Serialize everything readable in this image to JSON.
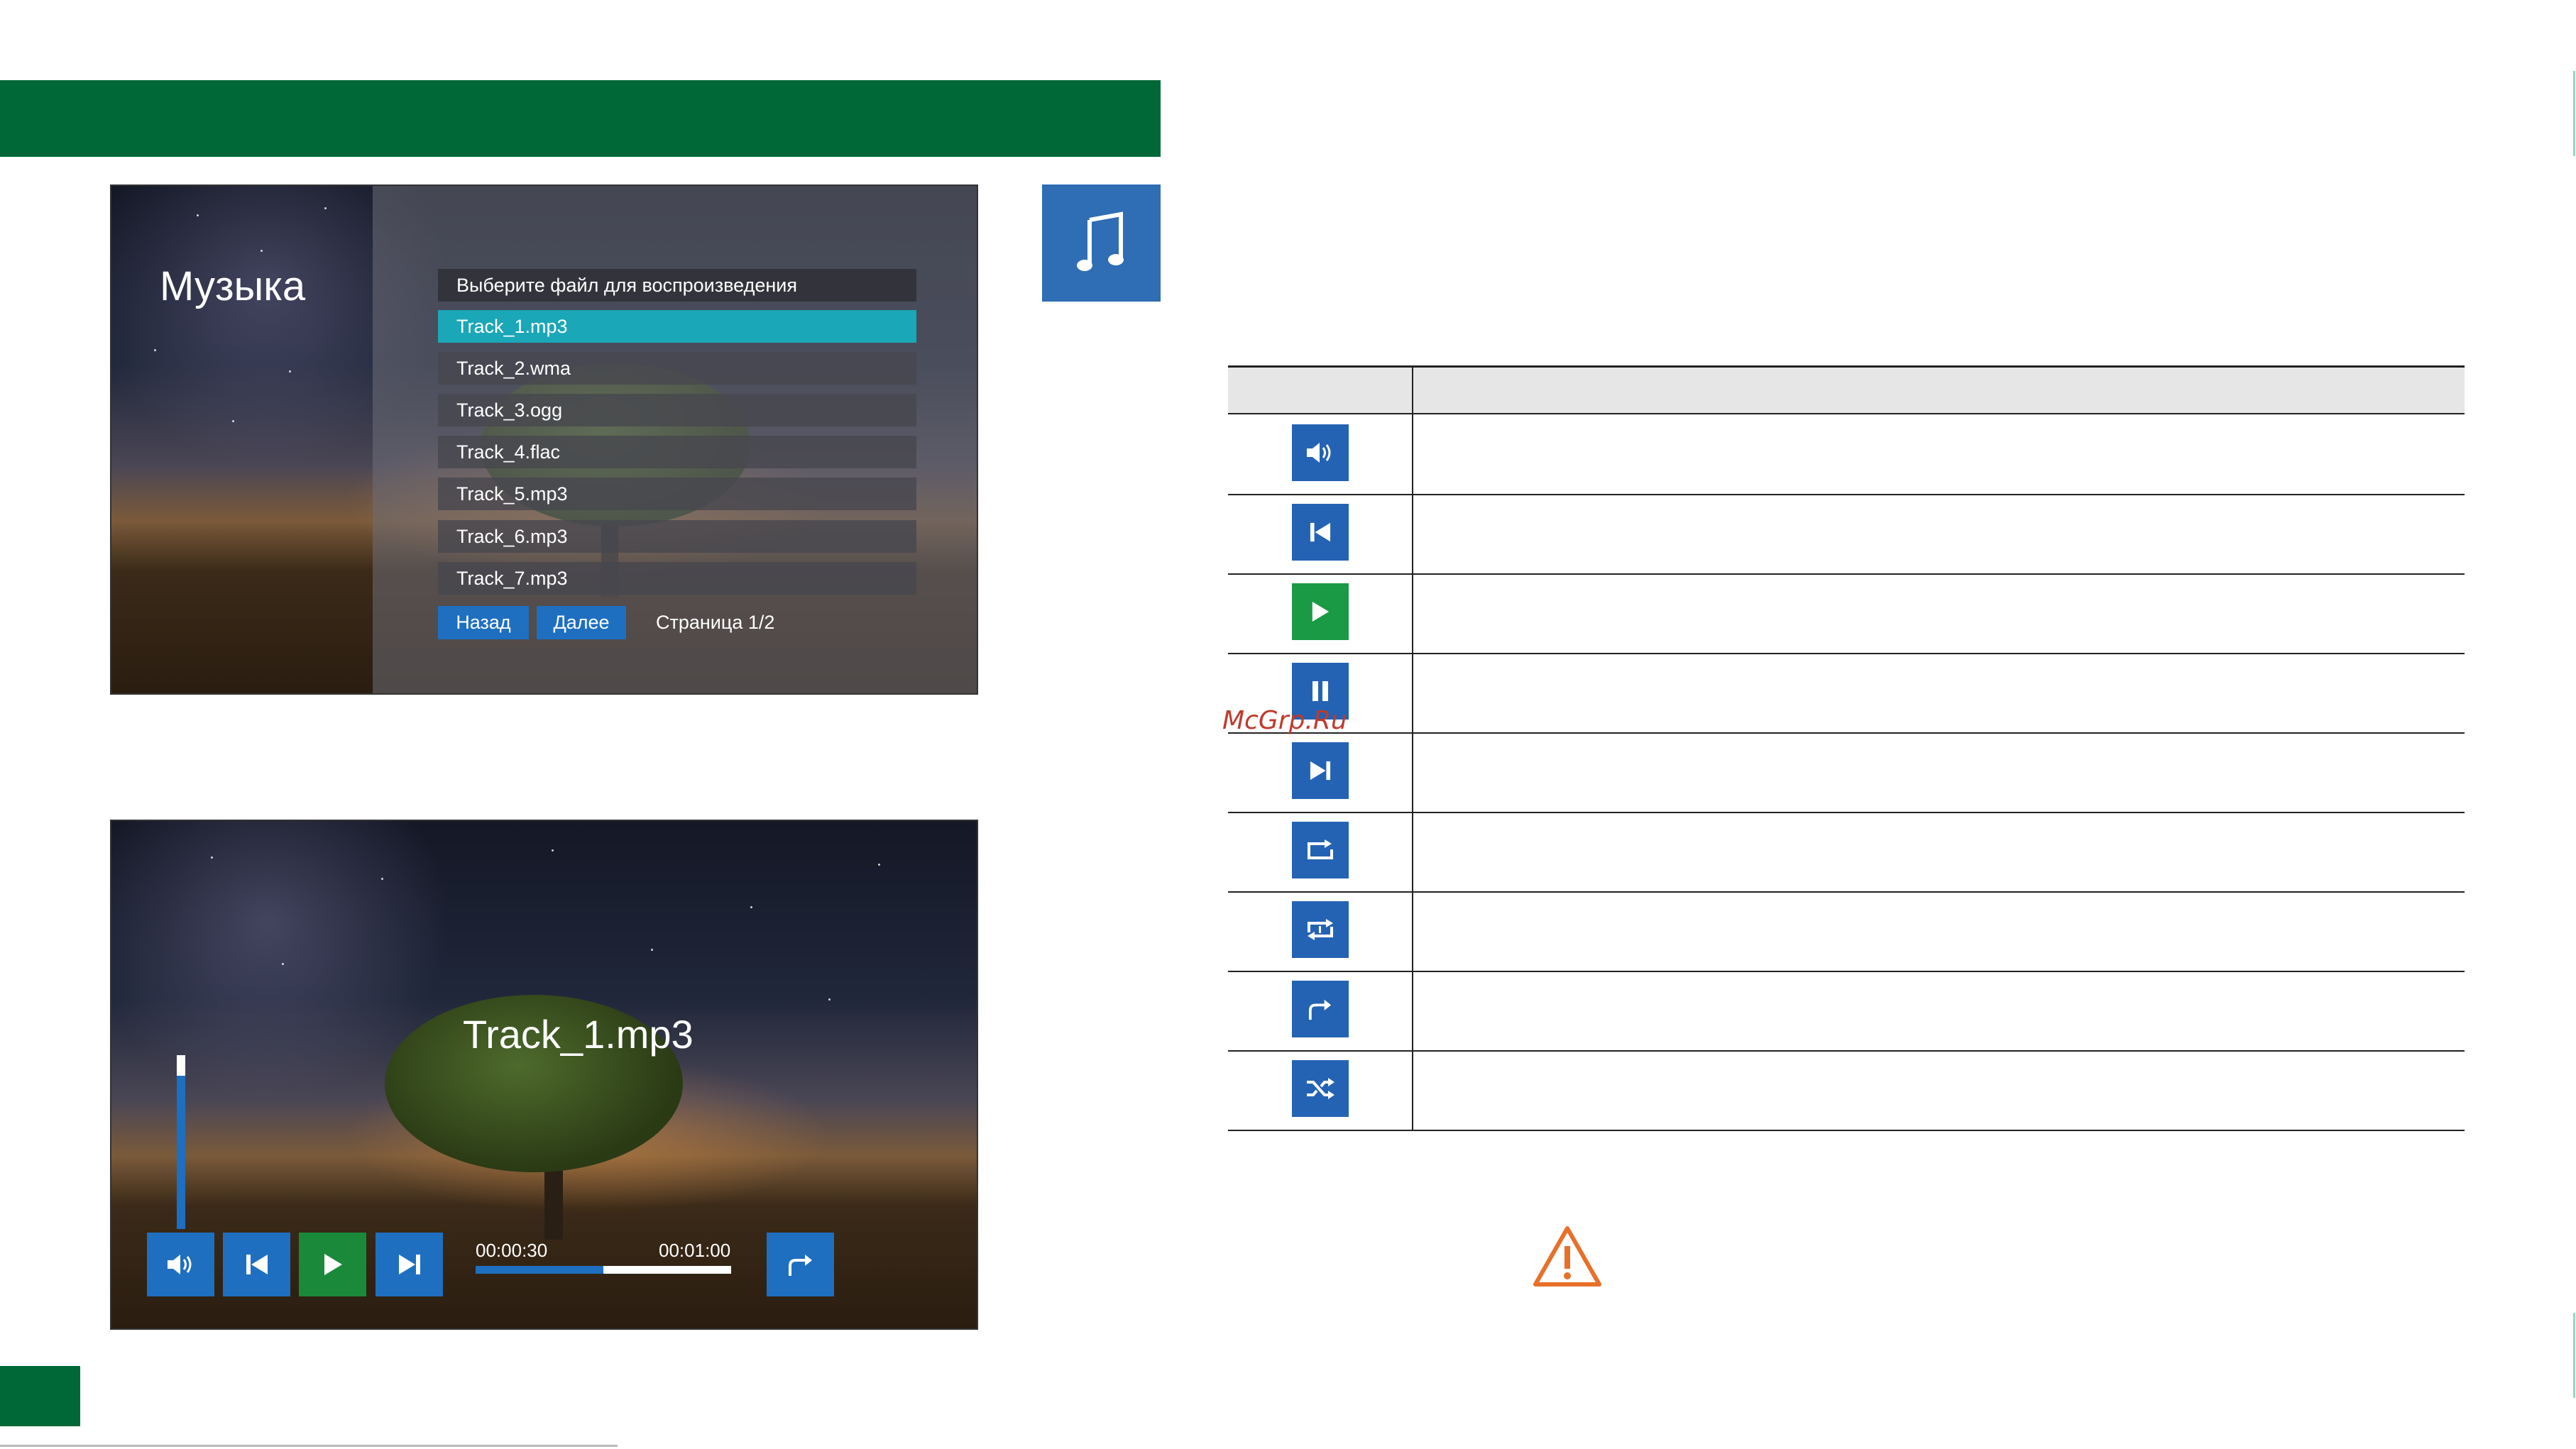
{
  "screen_list": {
    "title": "Музыка",
    "header": "Выберите файл для воспроизведения",
    "files": [
      "Track_1.mp3",
      "Track_2.wma",
      "Track_3.ogg",
      "Track_4.flac",
      "Track_5.mp3",
      "Track_6.mp3",
      "Track_7.mp3"
    ],
    "selected_index": 0,
    "back_label": "Назад",
    "next_label": "Далее",
    "page_indicator": "Страница 1/2"
  },
  "screen_player": {
    "track": "Track_1.mp3",
    "time_current": "00:00:30",
    "time_total": "00:01:00",
    "progress_fraction": 0.5,
    "volume_fraction": 0.12,
    "controls": [
      "volume-icon",
      "previous-icon",
      "play-icon",
      "next-icon",
      "exit-icon"
    ]
  },
  "table": {
    "rows": [
      "volume-icon",
      "previous-icon",
      "play-icon",
      "pause-icon",
      "next-icon",
      "repeat-one-icon",
      "repeat-all-icon",
      "exit-icon",
      "shuffle-icon"
    ]
  },
  "watermark": "McGrp.Ru",
  "colors": {
    "brand_green": "#006837",
    "button_blue": "#1e6fc0",
    "play_green": "#1a8a3a",
    "selected_row": "#1aa7b8",
    "warning": "#e8702a",
    "watermark": "#c0392b"
  }
}
